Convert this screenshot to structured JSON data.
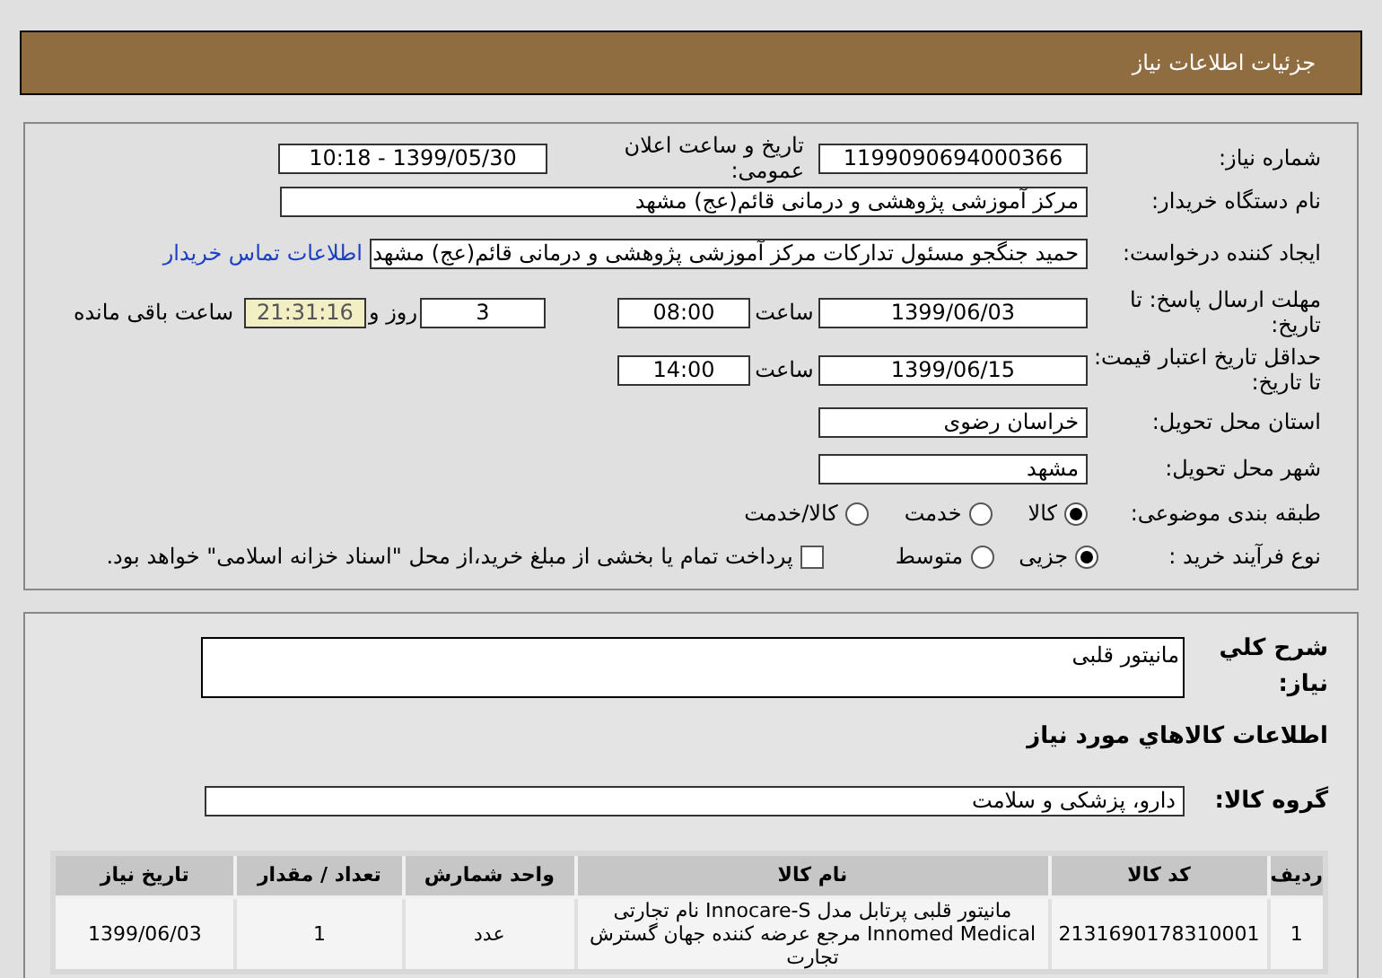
{
  "header": {
    "title": "جزئیات اطلاعات نیاز"
  },
  "details": {
    "need_number": {
      "label": "شماره نیاز:",
      "value": "1199090694000366"
    },
    "announce": {
      "label": "تاریخ و ساعت اعلان عمومی:",
      "value": "1399/05/30 - 10:18"
    },
    "buyer": {
      "label": "نام دستگاه خریدار:",
      "value": "مرکز آموزشی پژوهشی و درمانی قائم(عج) مشهد"
    },
    "creator": {
      "label": "ایجاد کننده درخواست:",
      "value": "حمید جنگجو مسئول تدارکات مرکز آموزشی پژوهشی و درمانی قائم(عج) مشهد",
      "link": "اطلاعات تماس خریدار"
    },
    "deadline": {
      "label": "مهلت ارسال پاسخ: تا تاریخ:",
      "date": "1399/06/03",
      "time_label": "ساعت",
      "time": "08:00",
      "days": "3",
      "days_label": "روز و",
      "remaining": "21:31:16",
      "remaining_label": "ساعت باقی مانده"
    },
    "validity": {
      "label": "حداقل تاریخ اعتبار قیمت: تا تاریخ:",
      "date": "1399/06/15",
      "time_label": "ساعت",
      "time": "14:00"
    },
    "province": {
      "label": "استان محل تحویل:",
      "value": "خراسان رضوی"
    },
    "city": {
      "label": "شهر محل تحویل:",
      "value": "مشهد"
    },
    "category": {
      "label": "طبقه بندی موضوعی:",
      "options": [
        {
          "label": "کالا",
          "selected": true
        },
        {
          "label": "خدمت",
          "selected": false
        },
        {
          "label": "کالا/خدمت",
          "selected": false
        }
      ]
    },
    "process": {
      "label": "نوع فرآیند خرید :",
      "options": [
        {
          "label": "جزیی",
          "selected": true
        },
        {
          "label": "متوسط",
          "selected": false
        }
      ],
      "payment": {
        "label": "پرداخت تمام یا بخشی از مبلغ خرید،از محل \"اسناد خزانه اسلامی\" خواهد بود.",
        "checked": false
      }
    }
  },
  "need": {
    "description_label": "شرح كلي نياز:",
    "description": "مانیتور قلبی",
    "goods_heading": "اطلاعات كالاهاي مورد نياز",
    "group_label": "گروه کالا:",
    "group": "دارو، پزشکی و سلامت",
    "table": {
      "columns": [
        "رديف",
        "کد کالا",
        "نام کالا",
        "واحد شمارش",
        "تعداد / مقدار",
        "تاریخ نیاز"
      ],
      "rows": [
        [
          "1",
          "2131690178310001",
          "مانیتور قلبی پرتابل مدل Innocare-S نام تجارتی Innomed Medical مرجع عرضه کننده جهان گسترش تجارت",
          "عدد",
          "1",
          "1399/06/03"
        ]
      ]
    }
  }
}
